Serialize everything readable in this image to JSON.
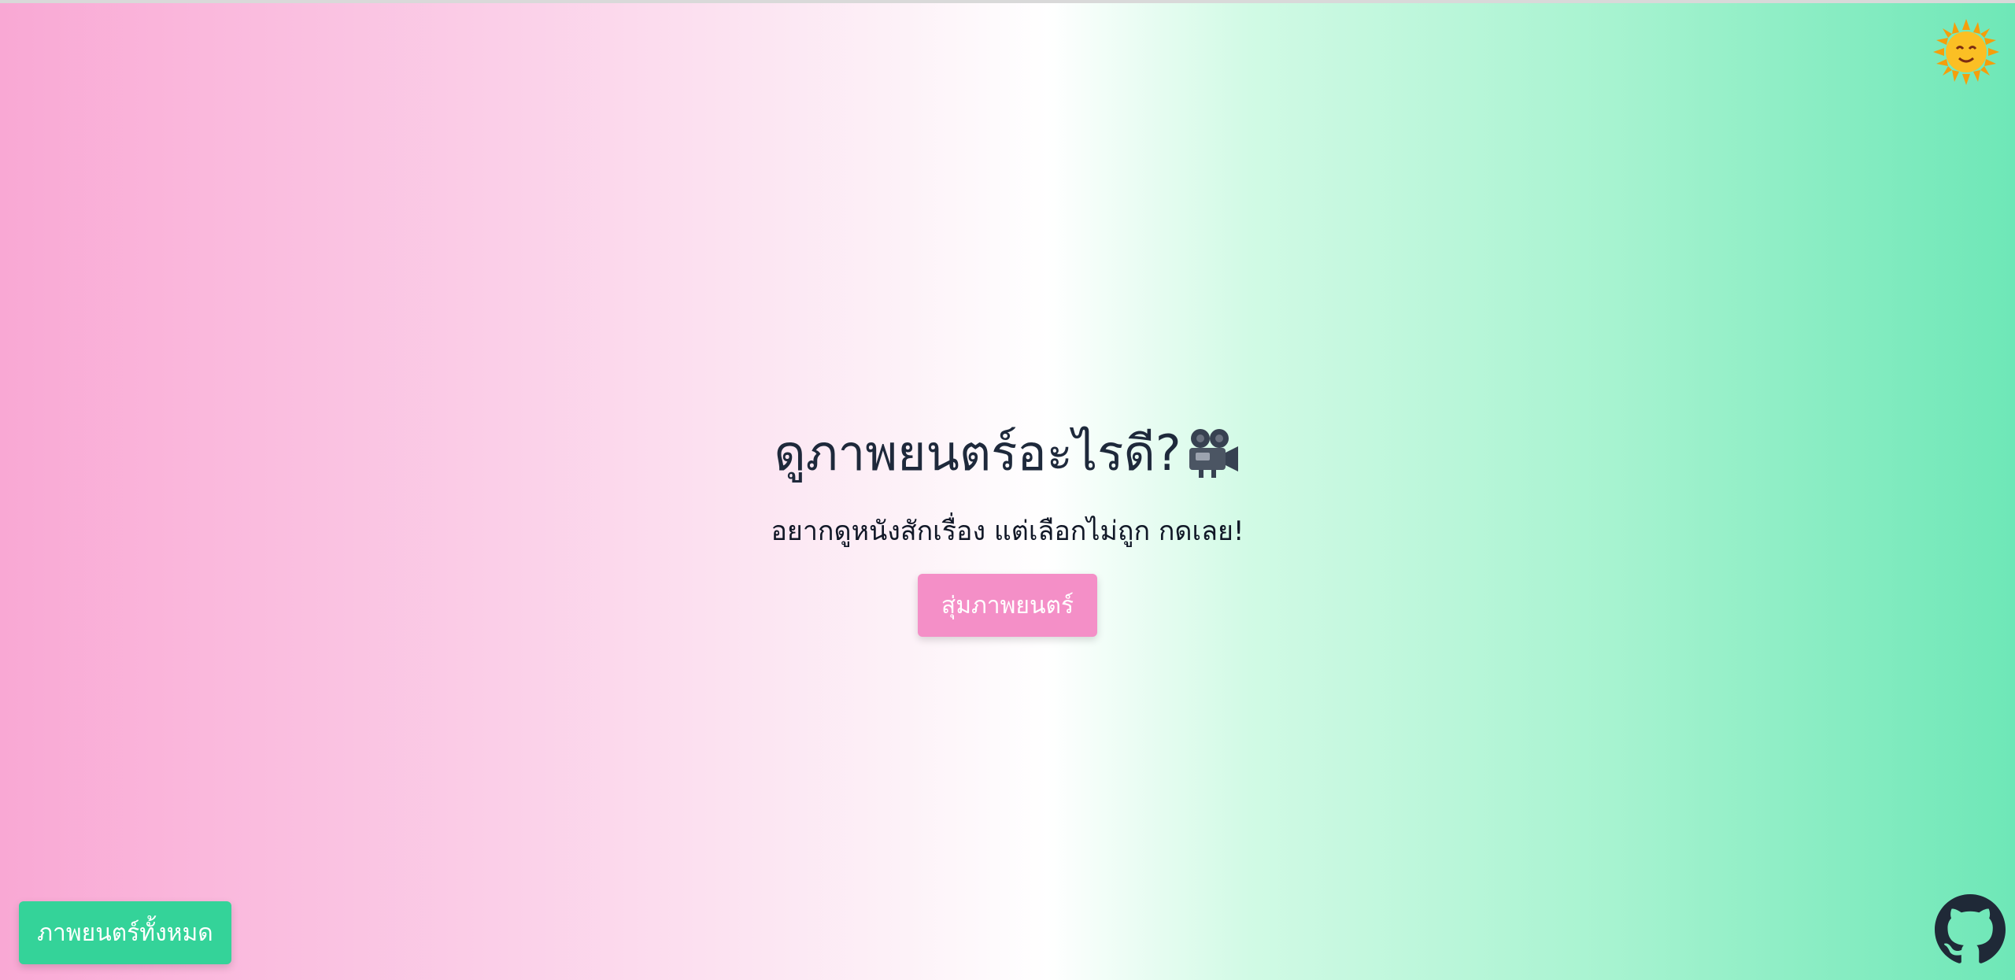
{
  "main": {
    "title": "ดูภาพยนตร์อะไรดี?",
    "title_icon": "movie-camera-icon",
    "subtitle": "อยากดูหนังสักเรื่อง แต่เลือกไม่ถูก กดเลย!",
    "random_button_label": "สุ่มภาพยนตร์"
  },
  "footer": {
    "all_movies_label": "ภาพยนตร์ทั้งหมด",
    "github_icon": "github-icon"
  },
  "header": {
    "theme_icon": "sun-icon"
  },
  "colors": {
    "pink_accent": "#f48fc7",
    "green_accent": "#34d399",
    "gradient_left": "#f9a8d4",
    "gradient_right": "#6ee7b7"
  }
}
